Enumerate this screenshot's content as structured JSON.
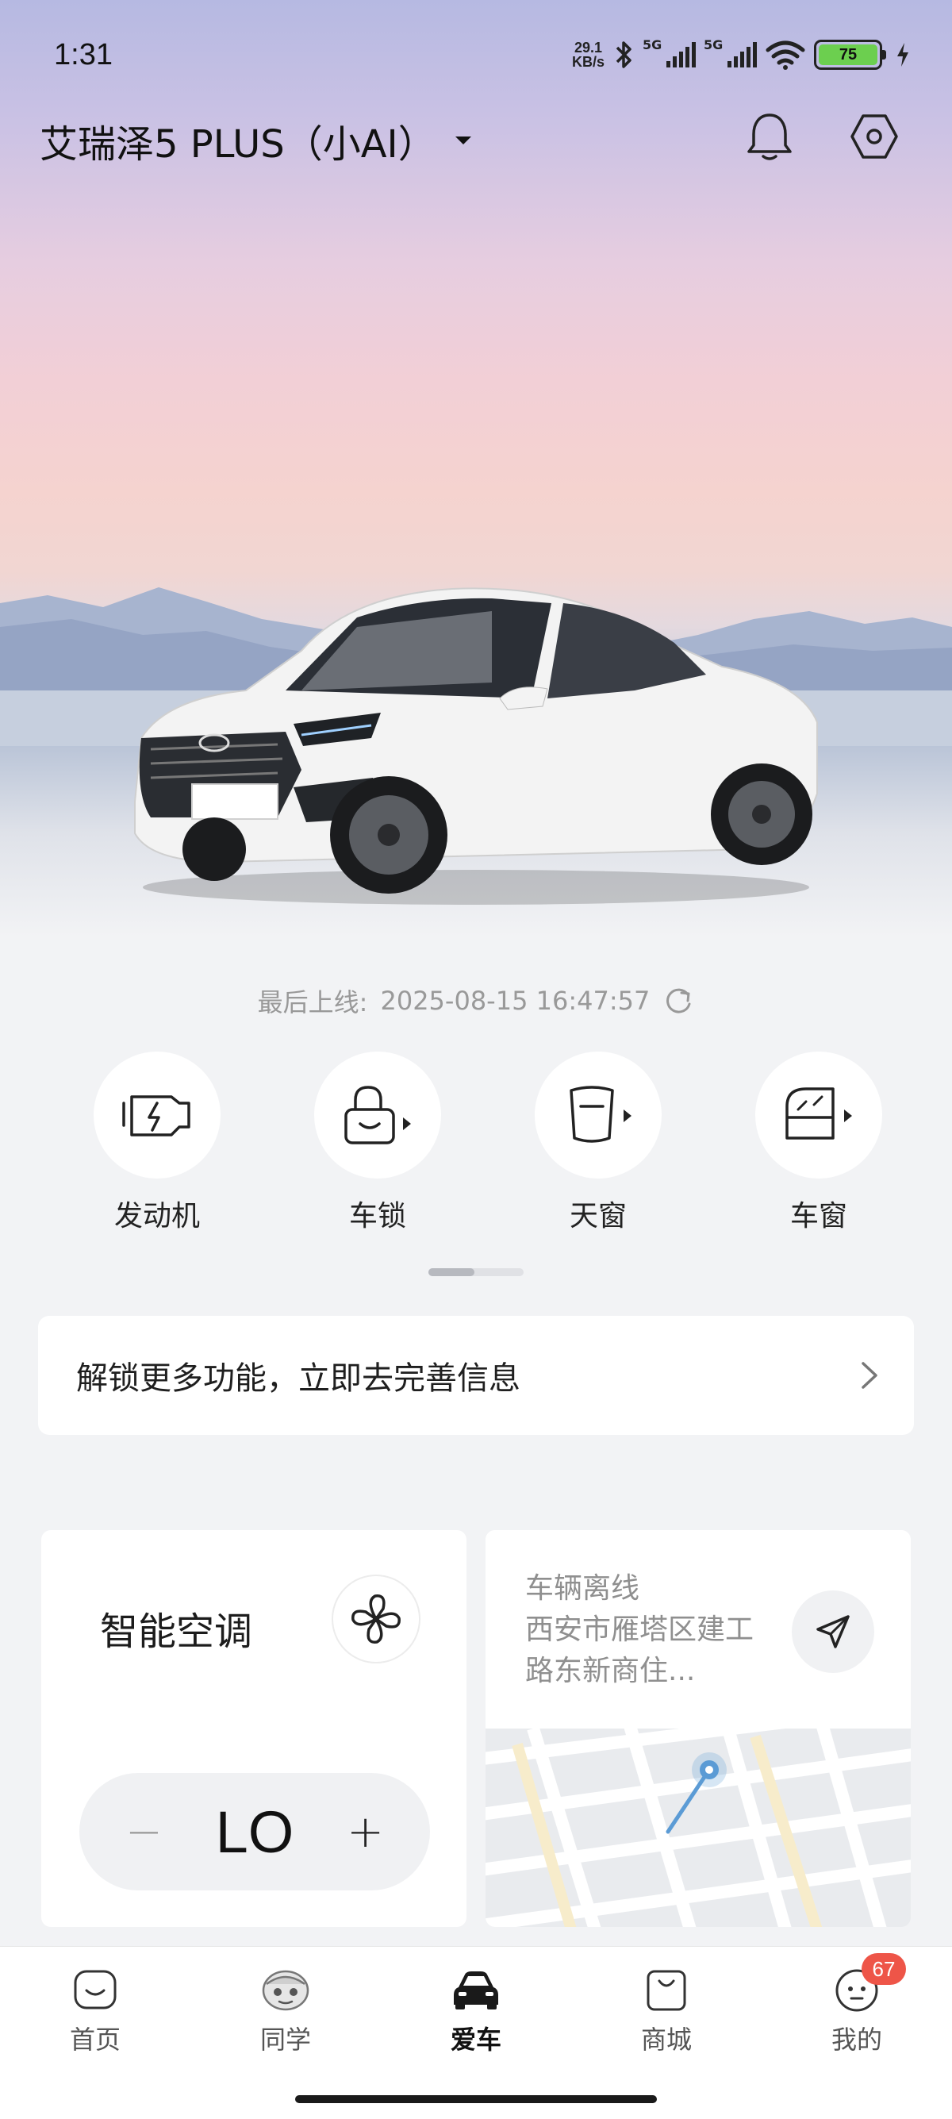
{
  "status_bar": {
    "time": "1:31",
    "net_speed_value": "29.1",
    "net_speed_unit": "KB/s",
    "sim1_label": "5G",
    "sim2_label": "5G",
    "battery": "75"
  },
  "header": {
    "car_name": "艾瑞泽5 PLUS（小AI）"
  },
  "status": {
    "last_online_label": "最后上线:",
    "last_online_time": "2025-08-15 16:47:57"
  },
  "controls": [
    {
      "label": "发动机",
      "icon": "engine-icon"
    },
    {
      "label": "车锁",
      "icon": "lock-icon"
    },
    {
      "label": "天窗",
      "icon": "sunroof-icon"
    },
    {
      "label": "车窗",
      "icon": "window-icon"
    }
  ],
  "banner": {
    "text": "解锁更多功能，立即去完善信息"
  },
  "ac_card": {
    "title": "智能空调",
    "temperature": "LO",
    "minus": "−",
    "plus": "+"
  },
  "location_card": {
    "status": "车辆离线",
    "address": "西安市雁塔区建工路东新商住..."
  },
  "bottom_nav": [
    {
      "label": "首页",
      "icon": "home-icon"
    },
    {
      "label": "同学",
      "icon": "classmate-icon"
    },
    {
      "label": "爱车",
      "icon": "car-icon",
      "active": true
    },
    {
      "label": "商城",
      "icon": "shop-icon"
    },
    {
      "label": "我的",
      "icon": "profile-icon",
      "badge": "67"
    }
  ],
  "colors": {
    "accent_badge": "#ee5548",
    "card_bg": "#ffffff",
    "page_bg": "#f2f3f5"
  }
}
